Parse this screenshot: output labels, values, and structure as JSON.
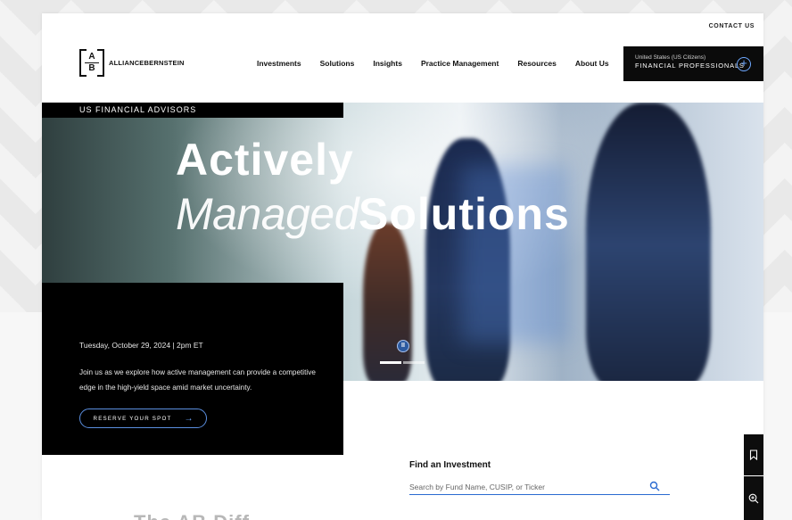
{
  "header": {
    "contact_label": "CONTACT US",
    "logo": {
      "mark_top": "A",
      "mark_bottom": "B",
      "name": "ALLIANCEBERNSTEIN"
    },
    "nav": [
      "Investments",
      "Solutions",
      "Insights",
      "Practice Management",
      "Resources",
      "About Us"
    ],
    "audience": {
      "region": "United States (US Citizens)",
      "role": "FINANCIAL PROFESSIONALS"
    }
  },
  "hero": {
    "eyebrow": "US FINANCIAL ADVISORS",
    "headline_line1": "Actively",
    "headline_italic": "Managed",
    "headline_bold": "Solutions",
    "event_date": "Tuesday, October 29, 2024 | 2pm ET",
    "event_description": "Join us as we explore how active management can provide a competitive edge in the high-yield space amid market uncertainty.",
    "cta_label": "RESERVE YOUR SPOT",
    "carousel": {
      "slides": 2,
      "active": 1
    }
  },
  "find": {
    "title": "Find an Investment",
    "placeholder": "Search by Fund Name, CUSIP, or Ticker"
  },
  "peek_text": "The AB Diff",
  "colors": {
    "accent": "#2a6bd1",
    "dark": "#000000",
    "accent_light": "#6ea8ff"
  },
  "icons": {
    "pause": "pause-icon",
    "search": "search-icon",
    "bookmark": "bookmark-icon",
    "zoom": "zoom-icon",
    "plus": "plus-circle-icon",
    "arrow": "arrow-right-icon"
  }
}
